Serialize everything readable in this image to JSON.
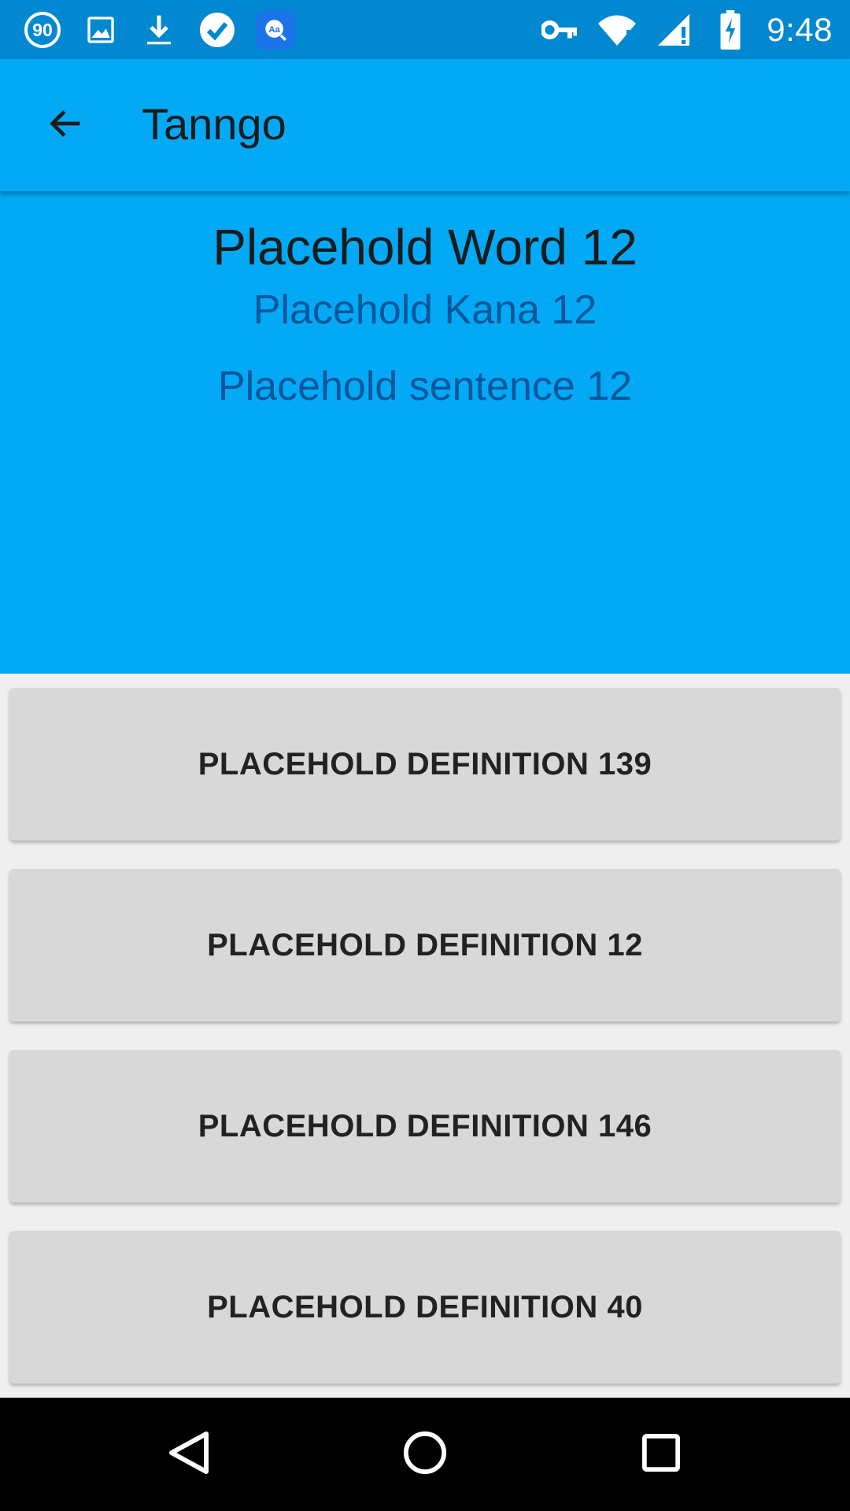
{
  "status_bar": {
    "time": "9:48",
    "notification_badge": "90",
    "left_icons": [
      "counter-badge-icon",
      "image-icon",
      "download-icon",
      "check-circle-icon",
      "dictionary-app-icon"
    ],
    "right_icons": [
      "vpn-key-icon",
      "wifi-icon",
      "cell-signal-icon",
      "battery-charging-icon"
    ]
  },
  "app_bar": {
    "title": "Tanngo",
    "back_icon": "arrow-left-icon"
  },
  "word_card": {
    "word": "Placehold Word 12",
    "kana": "Placehold Kana 12",
    "sentence": "Placehold sentence 12"
  },
  "definitions": [
    {
      "label": "PLACEHOLD DEFINITION 139"
    },
    {
      "label": "PLACEHOLD DEFINITION 12"
    },
    {
      "label": "PLACEHOLD DEFINITION 146"
    },
    {
      "label": "PLACEHOLD DEFINITION 40"
    }
  ],
  "nav_bar": {
    "icons": [
      "back-triangle-icon",
      "home-circle-icon",
      "recents-square-icon"
    ]
  },
  "colors": {
    "status_bar": "#0288d1",
    "primary": "#03a9f4",
    "secondary_text": "#01579b",
    "button_bg": "#d8d8d8",
    "background": "#efefef"
  }
}
